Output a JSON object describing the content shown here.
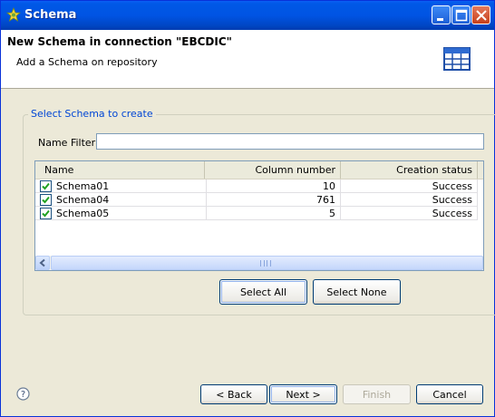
{
  "window": {
    "title": "Schema"
  },
  "header": {
    "title": "New Schema in connection \"EBCDIC\"",
    "subtitle": "Add a Schema on repository",
    "icon": "table-icon"
  },
  "group": {
    "label": "Select Schema to create"
  },
  "filter": {
    "label": "Name Filter:",
    "value": "",
    "placeholder": ""
  },
  "table": {
    "columns": [
      "Name",
      "Column number",
      "Creation status"
    ],
    "rows": [
      {
        "name": "Schema01",
        "columns": "10",
        "status": "Success",
        "checked": true
      },
      {
        "name": "Schema04",
        "columns": "761",
        "status": "Success",
        "checked": true
      },
      {
        "name": "Schema05",
        "columns": "5",
        "status": "Success",
        "checked": true
      }
    ],
    "scroll_grip": "III"
  },
  "actions": {
    "select_all": "Select All",
    "select_none": "Select None"
  },
  "footer": {
    "back": "< Back",
    "next": "Next >",
    "finish": "Finish",
    "cancel": "Cancel"
  },
  "colors": {
    "titlebar": "#0054e3",
    "group_label": "#0046d5",
    "check": "#21a121"
  }
}
